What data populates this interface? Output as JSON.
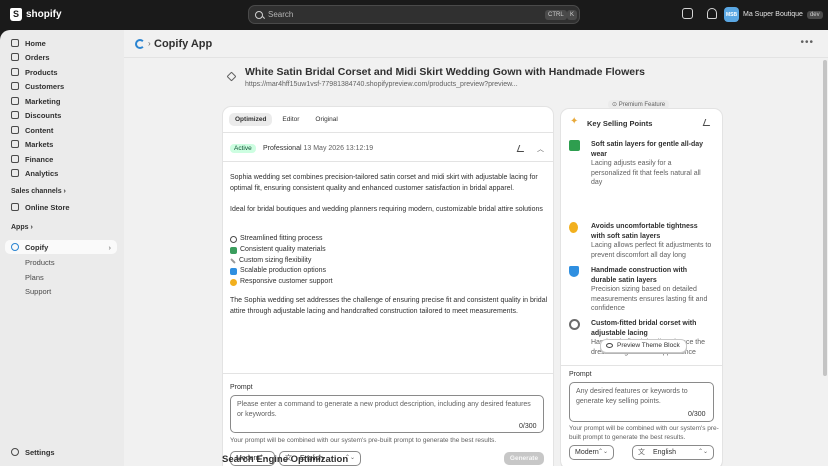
{
  "topbar": {
    "brand": "shopify",
    "search_placeholder": "Search",
    "shortcut_ctrl": "CTRL",
    "shortcut_k": "K",
    "store_initials": "MSB",
    "store_name": "Ma Super Boutique",
    "store_badge": "dev"
  },
  "sidebar": {
    "items": [
      {
        "label": "Home",
        "icon": "home-icon"
      },
      {
        "label": "Orders",
        "icon": "orders-icon"
      },
      {
        "label": "Products",
        "icon": "tag-icon"
      },
      {
        "label": "Customers",
        "icon": "person-icon"
      },
      {
        "label": "Marketing",
        "icon": "target-icon"
      },
      {
        "label": "Discounts",
        "icon": "discount-icon"
      },
      {
        "label": "Content",
        "icon": "content-icon"
      },
      {
        "label": "Markets",
        "icon": "globe-icon"
      },
      {
        "label": "Finance",
        "icon": "bank-icon"
      },
      {
        "label": "Analytics",
        "icon": "chart-icon"
      }
    ],
    "sales_channels_label": "Sales channels",
    "online_store": "Online Store",
    "apps_label": "Apps",
    "app_name": "Copify",
    "app_sub": [
      "Products",
      "Plans",
      "Support"
    ],
    "settings": "Settings"
  },
  "app": {
    "title": "Copify App",
    "product_title": "White Satin Bridal Corset and Midi Skirt Wedding Gown with Handmade Flowers",
    "product_url": "https://mar4hff15uw1vsf-77981384740.shopifypreview.com/products_preview?preview...",
    "tabs": [
      "Optimized",
      "Editor",
      "Original"
    ],
    "status_badge": "Active",
    "plan": "Professional",
    "timestamp": "13 May 2026 13:12:19",
    "description": {
      "p1": "Sophia wedding set combines precision-tailored satin corset and midi skirt with adjustable lacing for optimal fit, ensuring consistent quality and enhanced customer satisfaction in bridal apparel.",
      "p2": "Ideal for bridal boutiques and wedding planners requiring modern, customizable bridal attire solutions",
      "bullets": [
        "Streamlined fitting process",
        "Consistent quality materials",
        "Custom sizing flexibility",
        "Scalable production options",
        "Responsive customer support"
      ],
      "p3": "The Sophia wedding set addresses the challenge of ensuring precise fit and consistent quality in bridal attire through adjustable lacing and handcrafted construction tailored to meet measurements."
    },
    "prompt_label": "Prompt",
    "prompt_placeholder": "Please enter a command to generate a new product description, including any desired features or keywords.",
    "prompt_count": "0/300",
    "prompt_hint": "Your prompt will be combined with our system's pre-built prompt to generate the best results.",
    "style_value": "Modern",
    "language_value": "English",
    "generate_label": "Generate",
    "seo_heading": "Search Engine Optimization"
  },
  "ksp": {
    "premium_label": "Premium Feature",
    "title": "Key Selling Points",
    "points": [
      {
        "head": "Soft satin layers for gentle all-day wear",
        "desc": "Lacing adjusts easily for a personalized fit that feels natural all day",
        "icon": "checkmark-icon",
        "color": "#2e9e4f"
      },
      {
        "head": "Avoids uncomfortable tightness with soft satin layers",
        "desc": "Lacing allows perfect fit adjustments to prevent discomfort all day long",
        "icon": "lightbulb-icon",
        "color": "#f2b01e"
      },
      {
        "head": "Handmade construction with durable satin layers",
        "desc": "Precision sizing based on detailed measurements ensures lasting fit and confidence",
        "icon": "shield-icon",
        "color": "#2f8fe0"
      },
      {
        "head": "Custom-fitted bridal corset with adjustable lacing",
        "desc": "Handmade floral details enhance the dress's elegant bridal appearance",
        "icon": "target-icon",
        "color": "#6b6b6b"
      }
    ],
    "preview_button": "Preview Theme Block",
    "prompt_label": "Prompt",
    "prompt_placeholder": "Any desired features or keywords to generate key selling points.",
    "prompt_count": "0/300",
    "prompt_hint": "Your prompt will be combined with our system's pre-built prompt to generate the best results.",
    "style_value": "Modern",
    "language_value": "English"
  },
  "colors": {
    "accent": "#2a84d1",
    "active_badge_bg": "#cdfee1",
    "topbar": "#1a1a1a"
  }
}
